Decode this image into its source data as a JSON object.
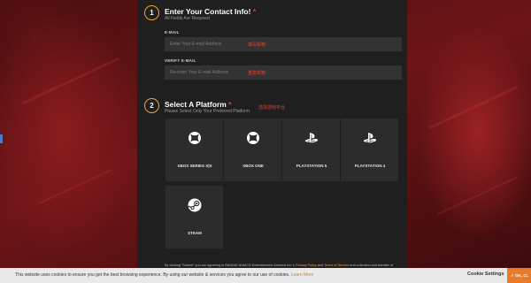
{
  "contact": {
    "step": "1",
    "title": "Enter Your Contact Info!",
    "required_marker": "*",
    "subtitle": "All Fields Are Required",
    "email_label": "E-MAIL",
    "email_placeholder": "Enter Your E-mail Address",
    "email_hint": "填写邮箱",
    "verify_label": "VERIFY E-MAIL",
    "verify_placeholder": "Re-enter Your E-mail Address",
    "verify_hint": "重复邮箱"
  },
  "platform": {
    "step": "2",
    "title": "Select A Platform",
    "required_marker": "*",
    "hint": "选择游戏平台",
    "subtitle": "Please Select Only Your Preferred Platform.",
    "options": [
      {
        "label": "XBOX SERIES X|S",
        "icon": "xbox-icon"
      },
      {
        "label": "XBOX ONE",
        "icon": "xbox-icon"
      },
      {
        "label": "PLAYSTATION 5",
        "icon": "playstation-icon"
      },
      {
        "label": "PLAYSTATION 4",
        "icon": "playstation-icon"
      },
      {
        "label": "STEAM",
        "icon": "steam-icon"
      }
    ]
  },
  "consent": {
    "text_start": "By clicking \"Submit\" you are agreeing to BANDAI NAMCO Entertainment America Inc.'s",
    "privacy_link": "Privacy Policy",
    "and": "and",
    "terms_link": "Terms of Service",
    "text_end": "and collection and transfer of"
  },
  "cookie_bar": {
    "text": "This website uses cookies to ensure you get the best browsing experience. By using our website & services you agree to our use of cookies.",
    "learn_more": "Learn More",
    "settings_label": "Cookie Settings",
    "ok_label": "✓ OK, CL"
  },
  "colors": {
    "accent": "#f2a33a",
    "required": "#e0412f",
    "panel": "#1f1f1f",
    "tile": "#2c2c2c",
    "cookie_ok": "#e77b2a"
  }
}
